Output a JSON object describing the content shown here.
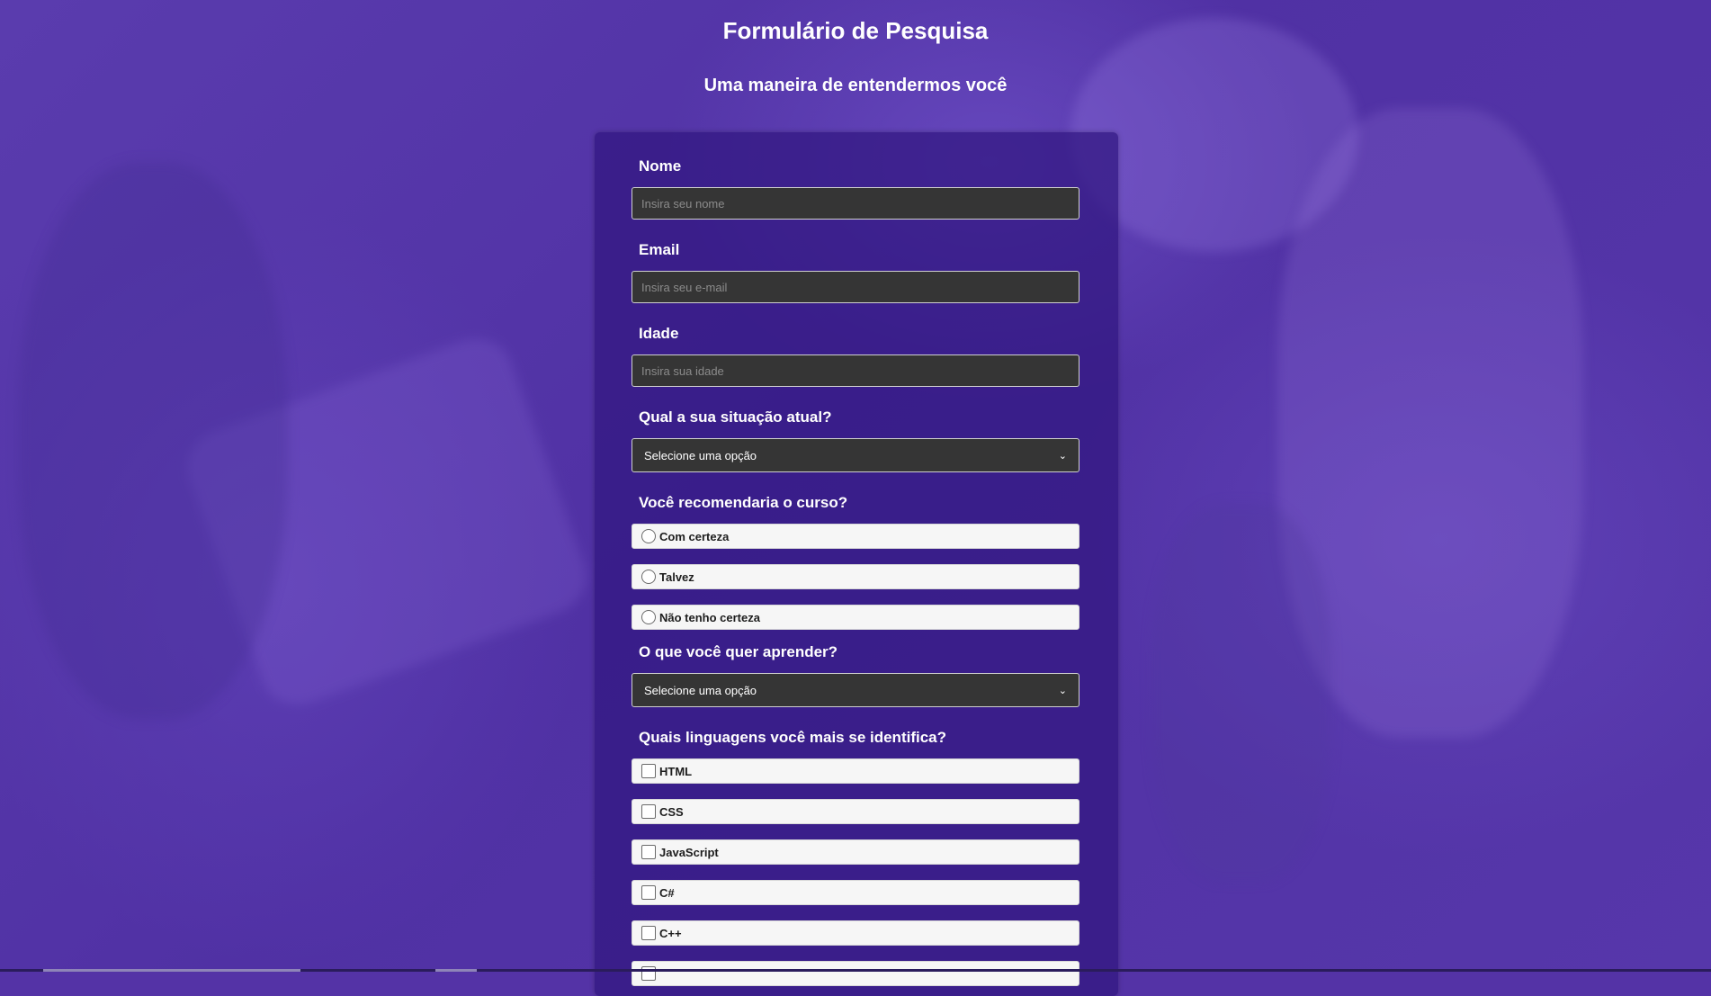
{
  "header": {
    "title": "Formulário de Pesquisa",
    "subtitle": "Uma maneira de entendermos você"
  },
  "form": {
    "name": {
      "label": "Nome",
      "placeholder": "Insira seu nome"
    },
    "email": {
      "label": "Email",
      "placeholder": "Insira seu e-mail"
    },
    "age": {
      "label": "Idade",
      "placeholder": "Insira sua idade"
    },
    "situation": {
      "label": "Qual a sua situação atual?",
      "selected": "Selecione uma opção"
    },
    "recommend": {
      "label": "Você recomendaria o curso?",
      "options": [
        "Com certeza",
        "Talvez",
        "Não tenho certeza"
      ]
    },
    "learn": {
      "label": "O que você quer aprender?",
      "selected": "Selecione uma opção"
    },
    "languages": {
      "label": "Quais linguagens você mais se identifica?",
      "options": [
        "HTML",
        "CSS",
        "JavaScript",
        "C#",
        "C++",
        ""
      ]
    }
  },
  "colors": {
    "background": "#5433a6",
    "card": "#30167f",
    "input_bg": "#353535"
  }
}
